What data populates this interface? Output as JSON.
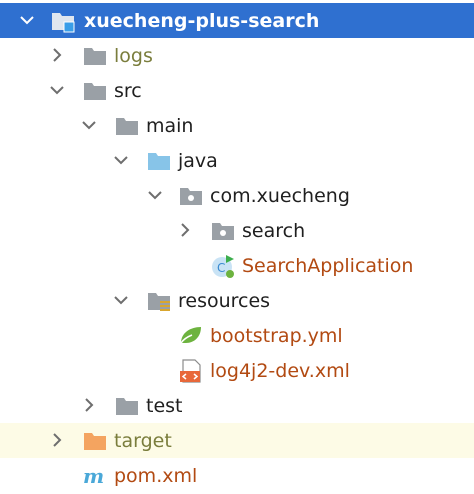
{
  "tree": {
    "root": {
      "label": "xuecheng-plus-search",
      "icon": "module-folder-icon",
      "expanded": true
    },
    "logs": {
      "label": "logs",
      "icon": "folder-icon",
      "expanded": false
    },
    "src": {
      "label": "src",
      "icon": "folder-icon",
      "expanded": true
    },
    "main": {
      "label": "main",
      "icon": "folder-icon",
      "expanded": true
    },
    "java": {
      "label": "java",
      "icon": "source-root-folder-icon",
      "expanded": true
    },
    "package": {
      "label": "com.xuecheng",
      "icon": "package-icon",
      "expanded": true
    },
    "search": {
      "label": "search",
      "icon": "package-icon",
      "expanded": false
    },
    "app": {
      "label": "SearchApplication",
      "icon": "spring-boot-class-icon"
    },
    "resources": {
      "label": "resources",
      "icon": "resources-root-folder-icon",
      "expanded": true
    },
    "bootstrap": {
      "label": "bootstrap.yml",
      "icon": "spring-yaml-icon"
    },
    "log4j2": {
      "label": "log4j2-dev.xml",
      "icon": "xml-file-icon"
    },
    "test": {
      "label": "test",
      "icon": "folder-icon",
      "expanded": false
    },
    "target": {
      "label": "target",
      "icon": "excluded-folder-icon",
      "expanded": false
    },
    "pom": {
      "label": "pom.xml",
      "icon": "maven-pom-icon"
    }
  },
  "colors": {
    "selection": "#2f70d0",
    "highlight_row": "#fdfbe6",
    "folder": "#9aa0a6",
    "source_root": "#87c4e8",
    "excluded_folder": "#f4a460",
    "spring_green": "#6db33f",
    "file_text": "#b24a12",
    "excluded_text": "#7a7d3c",
    "maven_m": "#4aa8d8"
  }
}
